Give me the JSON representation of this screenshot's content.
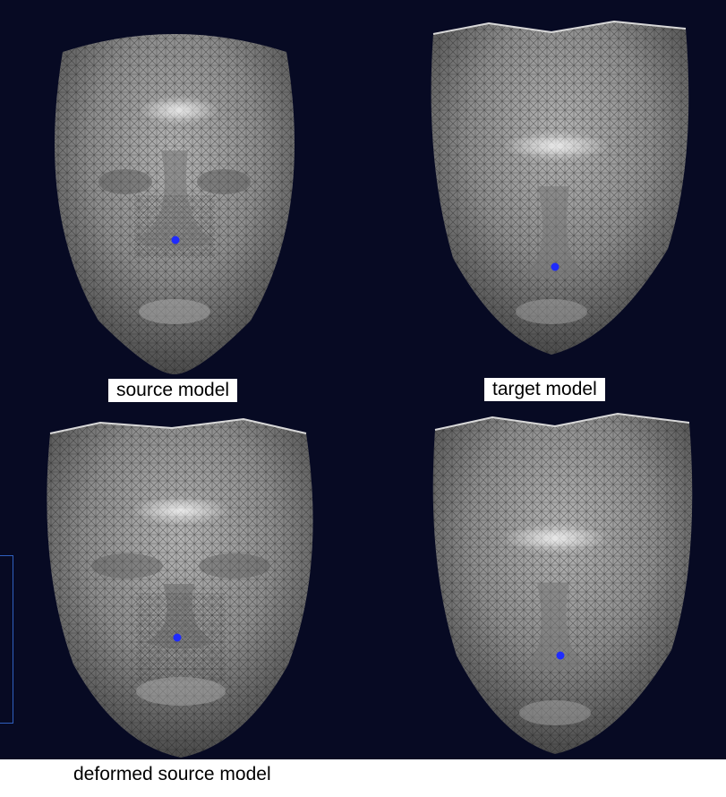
{
  "labels": {
    "source": "source model",
    "target": "target model",
    "deformed": "deformed source model"
  },
  "colors": {
    "background": "#070a23",
    "mesh_fill": "#8a8a8a",
    "mesh_line": "#2a2a2a",
    "marker": "#1f2bff"
  },
  "panels": [
    {
      "name": "source-model-render",
      "icon": "face-mesh-icon"
    },
    {
      "name": "target-model-render",
      "icon": "face-mesh-icon"
    },
    {
      "name": "deformed-source-model-render",
      "icon": "face-mesh-icon"
    },
    {
      "name": "deformed-target-model-render",
      "icon": "face-mesh-icon"
    }
  ]
}
